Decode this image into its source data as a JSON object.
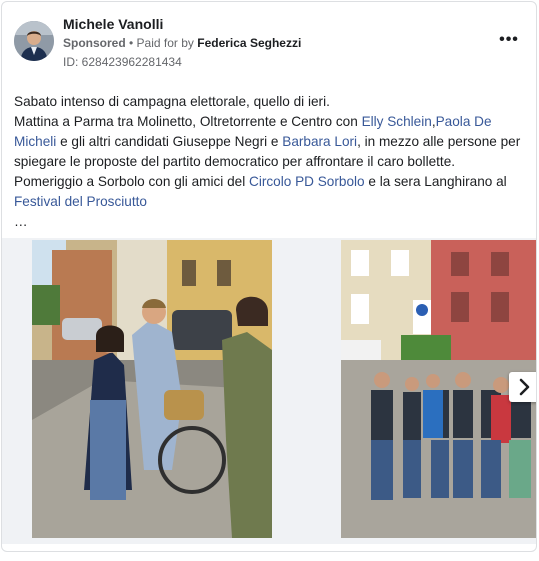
{
  "post": {
    "author": "Michele Vanolli",
    "sponsored": "Sponsored",
    "separator": " • ",
    "paid_for_by_prefix": "Paid for by ",
    "paid_for_by": "Federica Seghezzi",
    "ad_id": "ID: 628423962281434",
    "more_label": "•••"
  },
  "text": {
    "line1": "Sabato intenso di campagna elettorale, quello di ieri.",
    "p2_a": "Mattina a Parma tra Molinetto, Oltretorrente e Centro con ",
    "link_elly": "Elly Schlein",
    "comma": ",",
    "link_paola": "Paola De Micheli",
    "p2_b": " e gli altri candidati Giuseppe Negri e ",
    "link_barbara": "Barbara Lori",
    "p2_c": ", in mezzo alle persone per spiegare le proposte del partito democratico per affrontare il caro bollette.",
    "p3_a": "Pomeriggio a Sorbolo con gli amici del ",
    "link_circolo": "Circolo PD Sorbolo",
    "p3_b": " e la sera Langhirano al ",
    "link_festival": "Festival del Prosciutto",
    "ellipsis": "…"
  },
  "icons": {
    "more": "more-horizontal-icon",
    "next": "chevron-right-icon"
  },
  "colors": {
    "link": "#385898",
    "text": "#1c1e21",
    "secondary": "#65676b"
  }
}
